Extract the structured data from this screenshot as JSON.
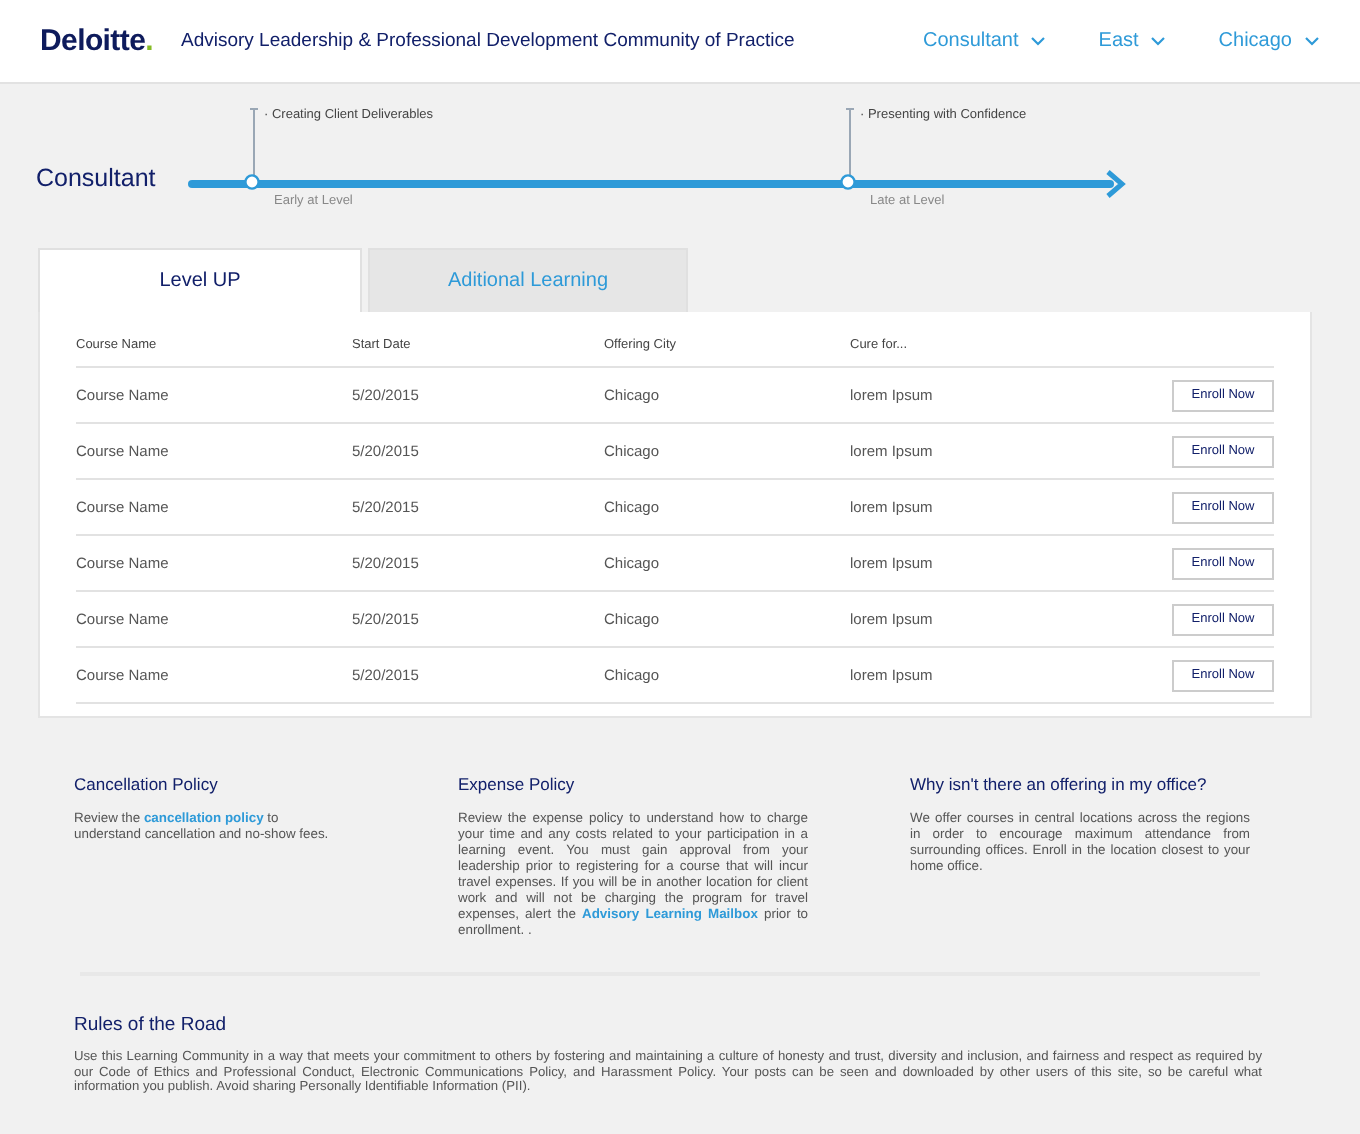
{
  "header": {
    "logo": "Deloitte.",
    "title": "Advisory Leadership & Professional Development Community of Practice",
    "filters": [
      {
        "label": "Consultant"
      },
      {
        "label": "East"
      },
      {
        "label": "Chicago"
      }
    ]
  },
  "timeline": {
    "level": "Consultant",
    "milestones": [
      {
        "topic": "· Creating Client Deliverables",
        "stage": "Early at Level"
      },
      {
        "topic": "· Presenting with Confidence",
        "stage": "Late at Level"
      }
    ]
  },
  "tabs": [
    {
      "label": "Level UP",
      "selected": true
    },
    {
      "label": "Aditional Learning",
      "selected": false
    }
  ],
  "table": {
    "columns": [
      "Course Name",
      "Start Date",
      "Offering City",
      "Cure for..."
    ],
    "rows": [
      {
        "cells": [
          "Course Name",
          "5/20/2015",
          "Chicago",
          "lorem Ipsum"
        ],
        "action": "Enroll Now"
      },
      {
        "cells": [
          "Course Name",
          "5/20/2015",
          "Chicago",
          "lorem Ipsum"
        ],
        "action": "Enroll Now"
      },
      {
        "cells": [
          "Course Name",
          "5/20/2015",
          "Chicago",
          "lorem Ipsum"
        ],
        "action": "Enroll Now"
      },
      {
        "cells": [
          "Course Name",
          "5/20/2015",
          "Chicago",
          "lorem Ipsum"
        ],
        "action": "Enroll Now"
      },
      {
        "cells": [
          "Course Name",
          "5/20/2015",
          "Chicago",
          "lorem Ipsum"
        ],
        "action": "Enroll Now"
      },
      {
        "cells": [
          "Course Name",
          "5/20/2015",
          "Chicago",
          "lorem Ipsum"
        ],
        "action": "Enroll Now"
      }
    ]
  },
  "policies": [
    {
      "title": "Cancellation Policy",
      "text": "Review the **cancellation policy** to understand cancellation and no-show fees."
    },
    {
      "title": "Expense Policy",
      "text": "Review the expense policy to understand how to charge your time and any costs related to your participation in a learning event. You must gain approval from your leadership prior to registering for a course that will incur travel expenses. If you will be in another location for client work and will not be charging the program for travel expenses, alert the **Advisory Learning Mailbox** prior to enrollment. ."
    },
    {
      "title": "Why isn't there an offering in my office?",
      "text": "We offer courses in central locations across the regions in order to encourage maximum attendance from surrounding offices. Enroll in the location closest to your home office."
    }
  ],
  "rules": {
    "title": "Rules of the Road",
    "text": "Use this Learning Community in a way that meets your commitment to others by fostering and maintaining a culture of honesty and trust, diversity and inclusion, and fairness and respect as required by our Code of Ethics and Professional Conduct, Electronic Communications Policy, and Harassment Policy. Your posts can be seen and downloaded by other users of this site, so be careful what information you publish. Avoid sharing Personally Identifiable Information (PII)."
  }
}
